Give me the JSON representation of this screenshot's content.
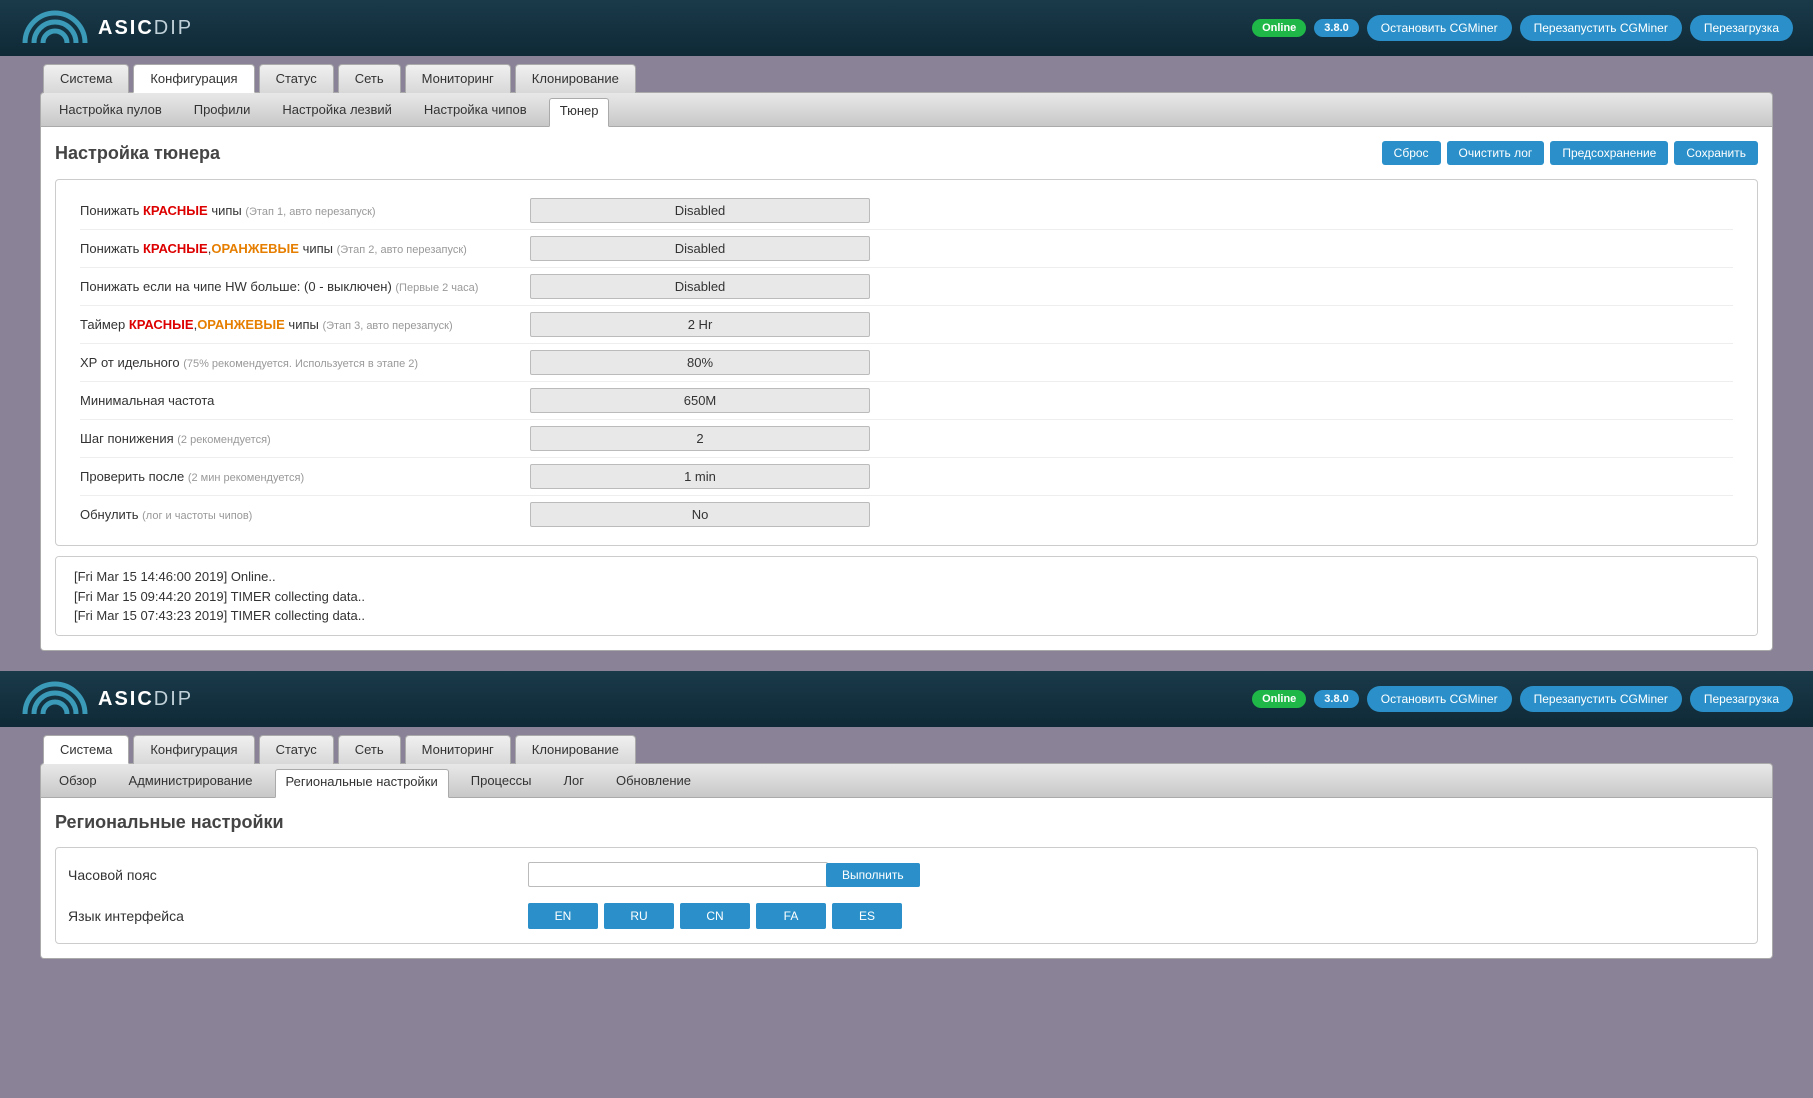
{
  "header": {
    "logo_bold": "ASIC",
    "logo_light": "DIP",
    "status": "Online",
    "version": "3.8.0",
    "buttons": {
      "stop": "Остановить CGMiner",
      "restart": "Перезапустить CGMiner",
      "reboot": "Перезагрузка"
    }
  },
  "window1": {
    "tabs": {
      "system": "Система",
      "config": "Конфигурация",
      "status": "Статус",
      "network": "Сеть",
      "monitoring": "Мониторинг",
      "cloning": "Клонирование"
    },
    "subtabs": {
      "pools": "Настройка пулов",
      "profiles": "Профили",
      "blades": "Настройка лезвий",
      "chips": "Настройка чипов",
      "tuner": "Тюнер"
    },
    "page_title": "Настройка тюнера",
    "actions": {
      "reset": "Сброс",
      "clear_log": "Очистить лог",
      "presave": "Предсохранение",
      "save": "Сохранить"
    },
    "rows": [
      {
        "pre": "Понижать ",
        "red": "КРАСНЫЕ",
        "orange": "",
        "mid": " чипы ",
        "muted": "(Этап 1, авто перезапуск)",
        "value": "Disabled"
      },
      {
        "pre": "Понижать ",
        "red": "КРАСНЫЕ",
        "orange": "ОРАНЖЕВЫЕ",
        "mid": " чипы ",
        "muted": "(Этап 2, авто перезапуск)",
        "value": "Disabled",
        "comma": ","
      },
      {
        "pre": "Понижать если на чипе HW больше: (0 - выключен) ",
        "red": "",
        "orange": "",
        "mid": "",
        "muted": "(Первые 2 часа)",
        "value": "Disabled"
      },
      {
        "pre": "Таймер ",
        "red": "КРАСНЫЕ",
        "orange": "ОРАНЖЕВЫЕ",
        "mid": " чипы ",
        "muted": "(Этап 3, авто перезапуск)",
        "value": "2 Hr",
        "comma": ","
      },
      {
        "pre": "ХР от идельного ",
        "red": "",
        "orange": "",
        "mid": "",
        "muted": "(75% рекомендуется. Используется в этапе 2)",
        "value": "80%"
      },
      {
        "pre": "Минимальная частота",
        "red": "",
        "orange": "",
        "mid": "",
        "muted": "",
        "value": "650M"
      },
      {
        "pre": "Шаг понижения ",
        "red": "",
        "orange": "",
        "mid": "",
        "muted": "(2 рекомендуется)",
        "value": "2"
      },
      {
        "pre": "Проверить после ",
        "red": "",
        "orange": "",
        "mid": "",
        "muted": "(2 мин рекомендуется)",
        "value": "1 min"
      },
      {
        "pre": "Обнулить ",
        "red": "",
        "orange": "",
        "mid": "",
        "muted": "(лог и частоты чипов)",
        "value": "No"
      }
    ],
    "log": [
      "[Fri Mar 15 14:46:00 2019] Online..",
      "[Fri Mar 15 09:44:20 2019] TIMER collecting data..",
      "[Fri Mar 15 07:43:23 2019] TIMER collecting data.."
    ]
  },
  "window2": {
    "tabs": {
      "system": "Система",
      "config": "Конфигурация",
      "status": "Статус",
      "network": "Сеть",
      "monitoring": "Мониторинг",
      "cloning": "Клонирование"
    },
    "subtabs": {
      "overview": "Обзор",
      "admin": "Администрирование",
      "regional": "Региональные настройки",
      "processes": "Процессы",
      "log": "Лог",
      "update": "Обновление"
    },
    "page_title": "Региональные настройки",
    "timezone_label": "Часовой пояс",
    "timezone_value": "",
    "execute": "Выполнить",
    "lang_label": "Язык интерфейса",
    "langs": [
      "EN",
      "RU",
      "CN",
      "FA",
      "ES"
    ]
  }
}
